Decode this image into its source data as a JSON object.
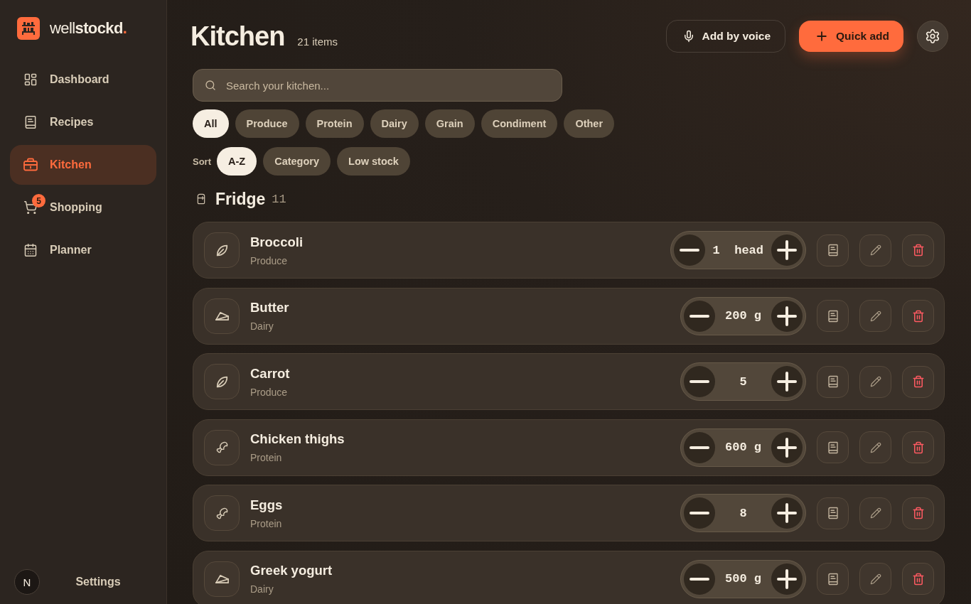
{
  "sidebar": {
    "logo": {
      "light": "well",
      "bold": "stockd",
      "accent": "."
    },
    "nav": [
      {
        "kind": "dashboard",
        "label": "Dashboard",
        "selected": false
      },
      {
        "kind": "recipes",
        "label": "Recipes",
        "selected": false
      },
      {
        "kind": "kitchen",
        "label": "Kitchen",
        "selected": true
      },
      {
        "kind": "shopping",
        "label": "Shopping",
        "badge": "5",
        "selected": false
      },
      {
        "kind": "planner",
        "label": "Planner",
        "selected": false
      }
    ],
    "footer": {
      "avatar": "N",
      "settings": "Settings"
    }
  },
  "header": {
    "title": "Kitchen",
    "count": "21 items",
    "actions": [
      {
        "kind": "voice",
        "label": "Add by voice"
      },
      {
        "kind": "primary",
        "label": "Quick add"
      }
    ]
  },
  "search": {
    "placeholder": "Search your kitchen..."
  },
  "filters": [
    {
      "label": "All",
      "selected": true
    },
    {
      "label": "Produce",
      "selected": false
    },
    {
      "label": "Protein",
      "selected": false
    },
    {
      "label": "Dairy",
      "selected": false
    },
    {
      "label": "Grain",
      "selected": false
    },
    {
      "label": "Condiment",
      "selected": false
    },
    {
      "label": "Other",
      "selected": false
    }
  ],
  "sort": {
    "label": "Sort",
    "options": [
      {
        "label": "A-Z",
        "selected": true
      },
      {
        "label": "Category",
        "selected": false
      },
      {
        "label": "Low stock",
        "selected": false
      }
    ]
  },
  "sections": [
    {
      "title": "Fridge",
      "count": "11",
      "items": [
        {
          "kind": "produce",
          "name": "Broccoli",
          "category": "Produce",
          "quantity": "1  head"
        },
        {
          "kind": "dairy",
          "name": "Butter",
          "category": "Dairy",
          "quantity": "200 g"
        },
        {
          "kind": "produce",
          "name": "Carrot",
          "category": "Produce",
          "quantity": "5"
        },
        {
          "kind": "protein",
          "name": "Chicken thighs",
          "category": "Protein",
          "quantity": "600 g"
        },
        {
          "kind": "protein",
          "name": "Eggs",
          "category": "Protein",
          "quantity": "8"
        },
        {
          "kind": "dairy",
          "name": "Greek yogurt",
          "category": "Dairy",
          "quantity": "500 g"
        }
      ]
    }
  ]
}
